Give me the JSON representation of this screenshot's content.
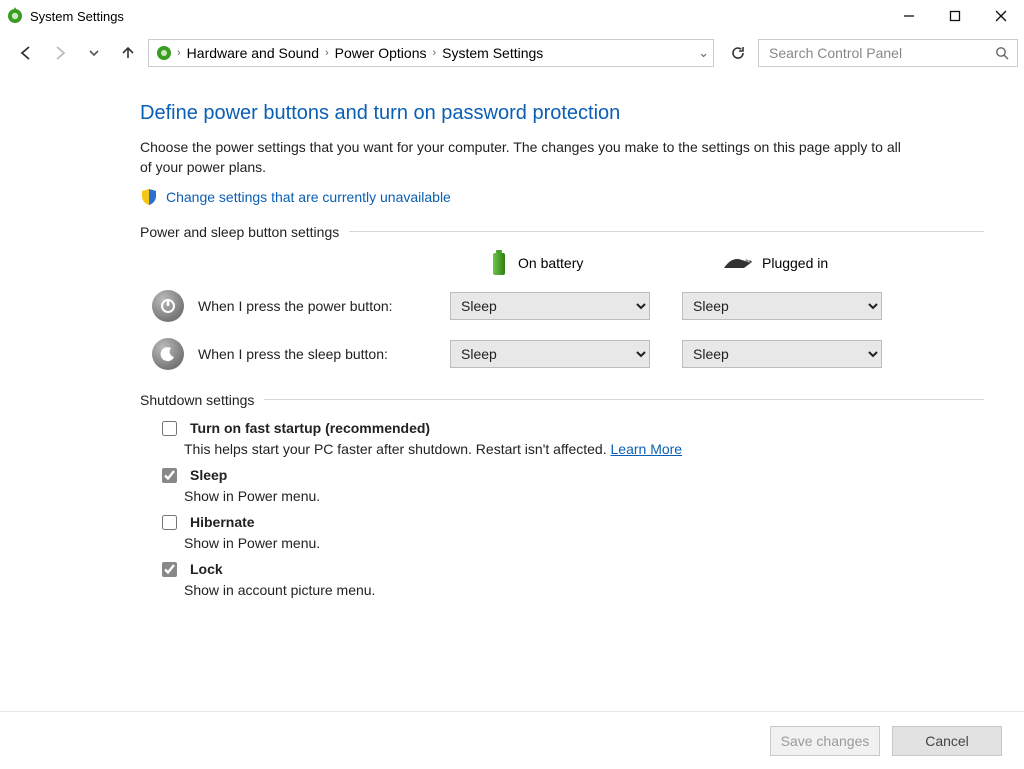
{
  "window": {
    "title": "System Settings"
  },
  "breadcrumb": {
    "item1": "Hardware and Sound",
    "item2": "Power Options",
    "item3": "System Settings"
  },
  "search": {
    "placeholder": "Search Control Panel"
  },
  "page": {
    "title": "Define power buttons and turn on password protection",
    "intro": "Choose the power settings that you want for your computer. The changes you make to the settings on this page apply to all of your power plans.",
    "change_link": "Change settings that are currently unavailable"
  },
  "power_section": {
    "label": "Power and sleep button settings",
    "col_battery": "On battery",
    "col_plugged": "Plugged in",
    "row_power_label": "When I press the power button:",
    "row_sleep_label": "When I press the sleep button:",
    "power_battery": "Sleep",
    "power_plugged": "Sleep",
    "sleep_battery": "Sleep",
    "sleep_plugged": "Sleep"
  },
  "shutdown_section": {
    "label": "Shutdown settings",
    "fast_startup_label": "Turn on fast startup (recommended)",
    "fast_startup_sub_a": "This helps start your PC faster after shutdown. Restart isn't affected. ",
    "fast_startup_sub_link": "Learn More",
    "sleep_label": "Sleep",
    "sleep_sub": "Show in Power menu.",
    "hibernate_label": "Hibernate",
    "hibernate_sub": "Show in Power menu.",
    "lock_label": "Lock",
    "lock_sub": "Show in account picture menu."
  },
  "footer": {
    "save": "Save changes",
    "cancel": "Cancel"
  }
}
